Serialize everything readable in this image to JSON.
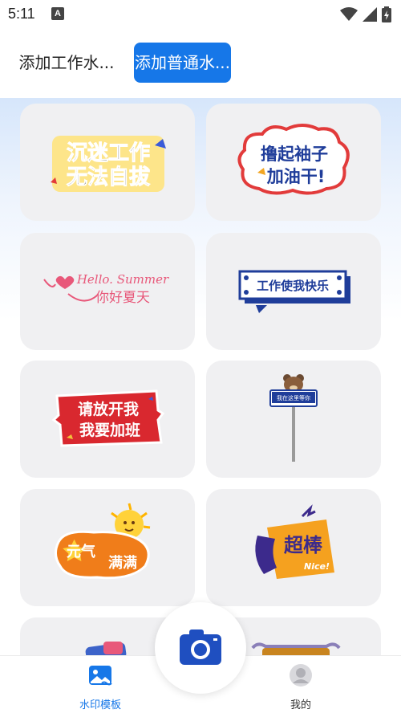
{
  "status_bar": {
    "time": "5:11",
    "notification_icon": "a-icon",
    "right_icons": [
      "wifi-icon",
      "signal-icon",
      "battery-icon"
    ]
  },
  "tabs": [
    {
      "label": "添加工作水...",
      "selected": false
    },
    {
      "label": "添加普通水...",
      "selected": true
    }
  ],
  "templates": [
    {
      "lines": [
        "沉迷工作",
        "无法自拔"
      ]
    },
    {
      "lines": [
        "撸起袖子",
        "加油干!"
      ]
    },
    {
      "lines": [
        "Hello. Summer",
        "你好夏天"
      ]
    },
    {
      "lines": [
        "工作使我快乐"
      ]
    },
    {
      "lines": [
        "请放开我",
        "我要加班"
      ]
    },
    {
      "lines": [
        "我在这里等你"
      ]
    },
    {
      "lines": [
        "元气",
        "满满"
      ]
    },
    {
      "lines": [
        "超棒",
        "Nice!"
      ]
    }
  ],
  "bottom_nav": [
    {
      "label": "水印模板",
      "icon": "image-icon",
      "active": true
    },
    {
      "label": "我的",
      "icon": "profile-icon",
      "active": false
    }
  ],
  "fab": {
    "icon": "camera-icon"
  },
  "colors": {
    "accent": "#1677e8",
    "card_bg": "#f0f0f2"
  }
}
